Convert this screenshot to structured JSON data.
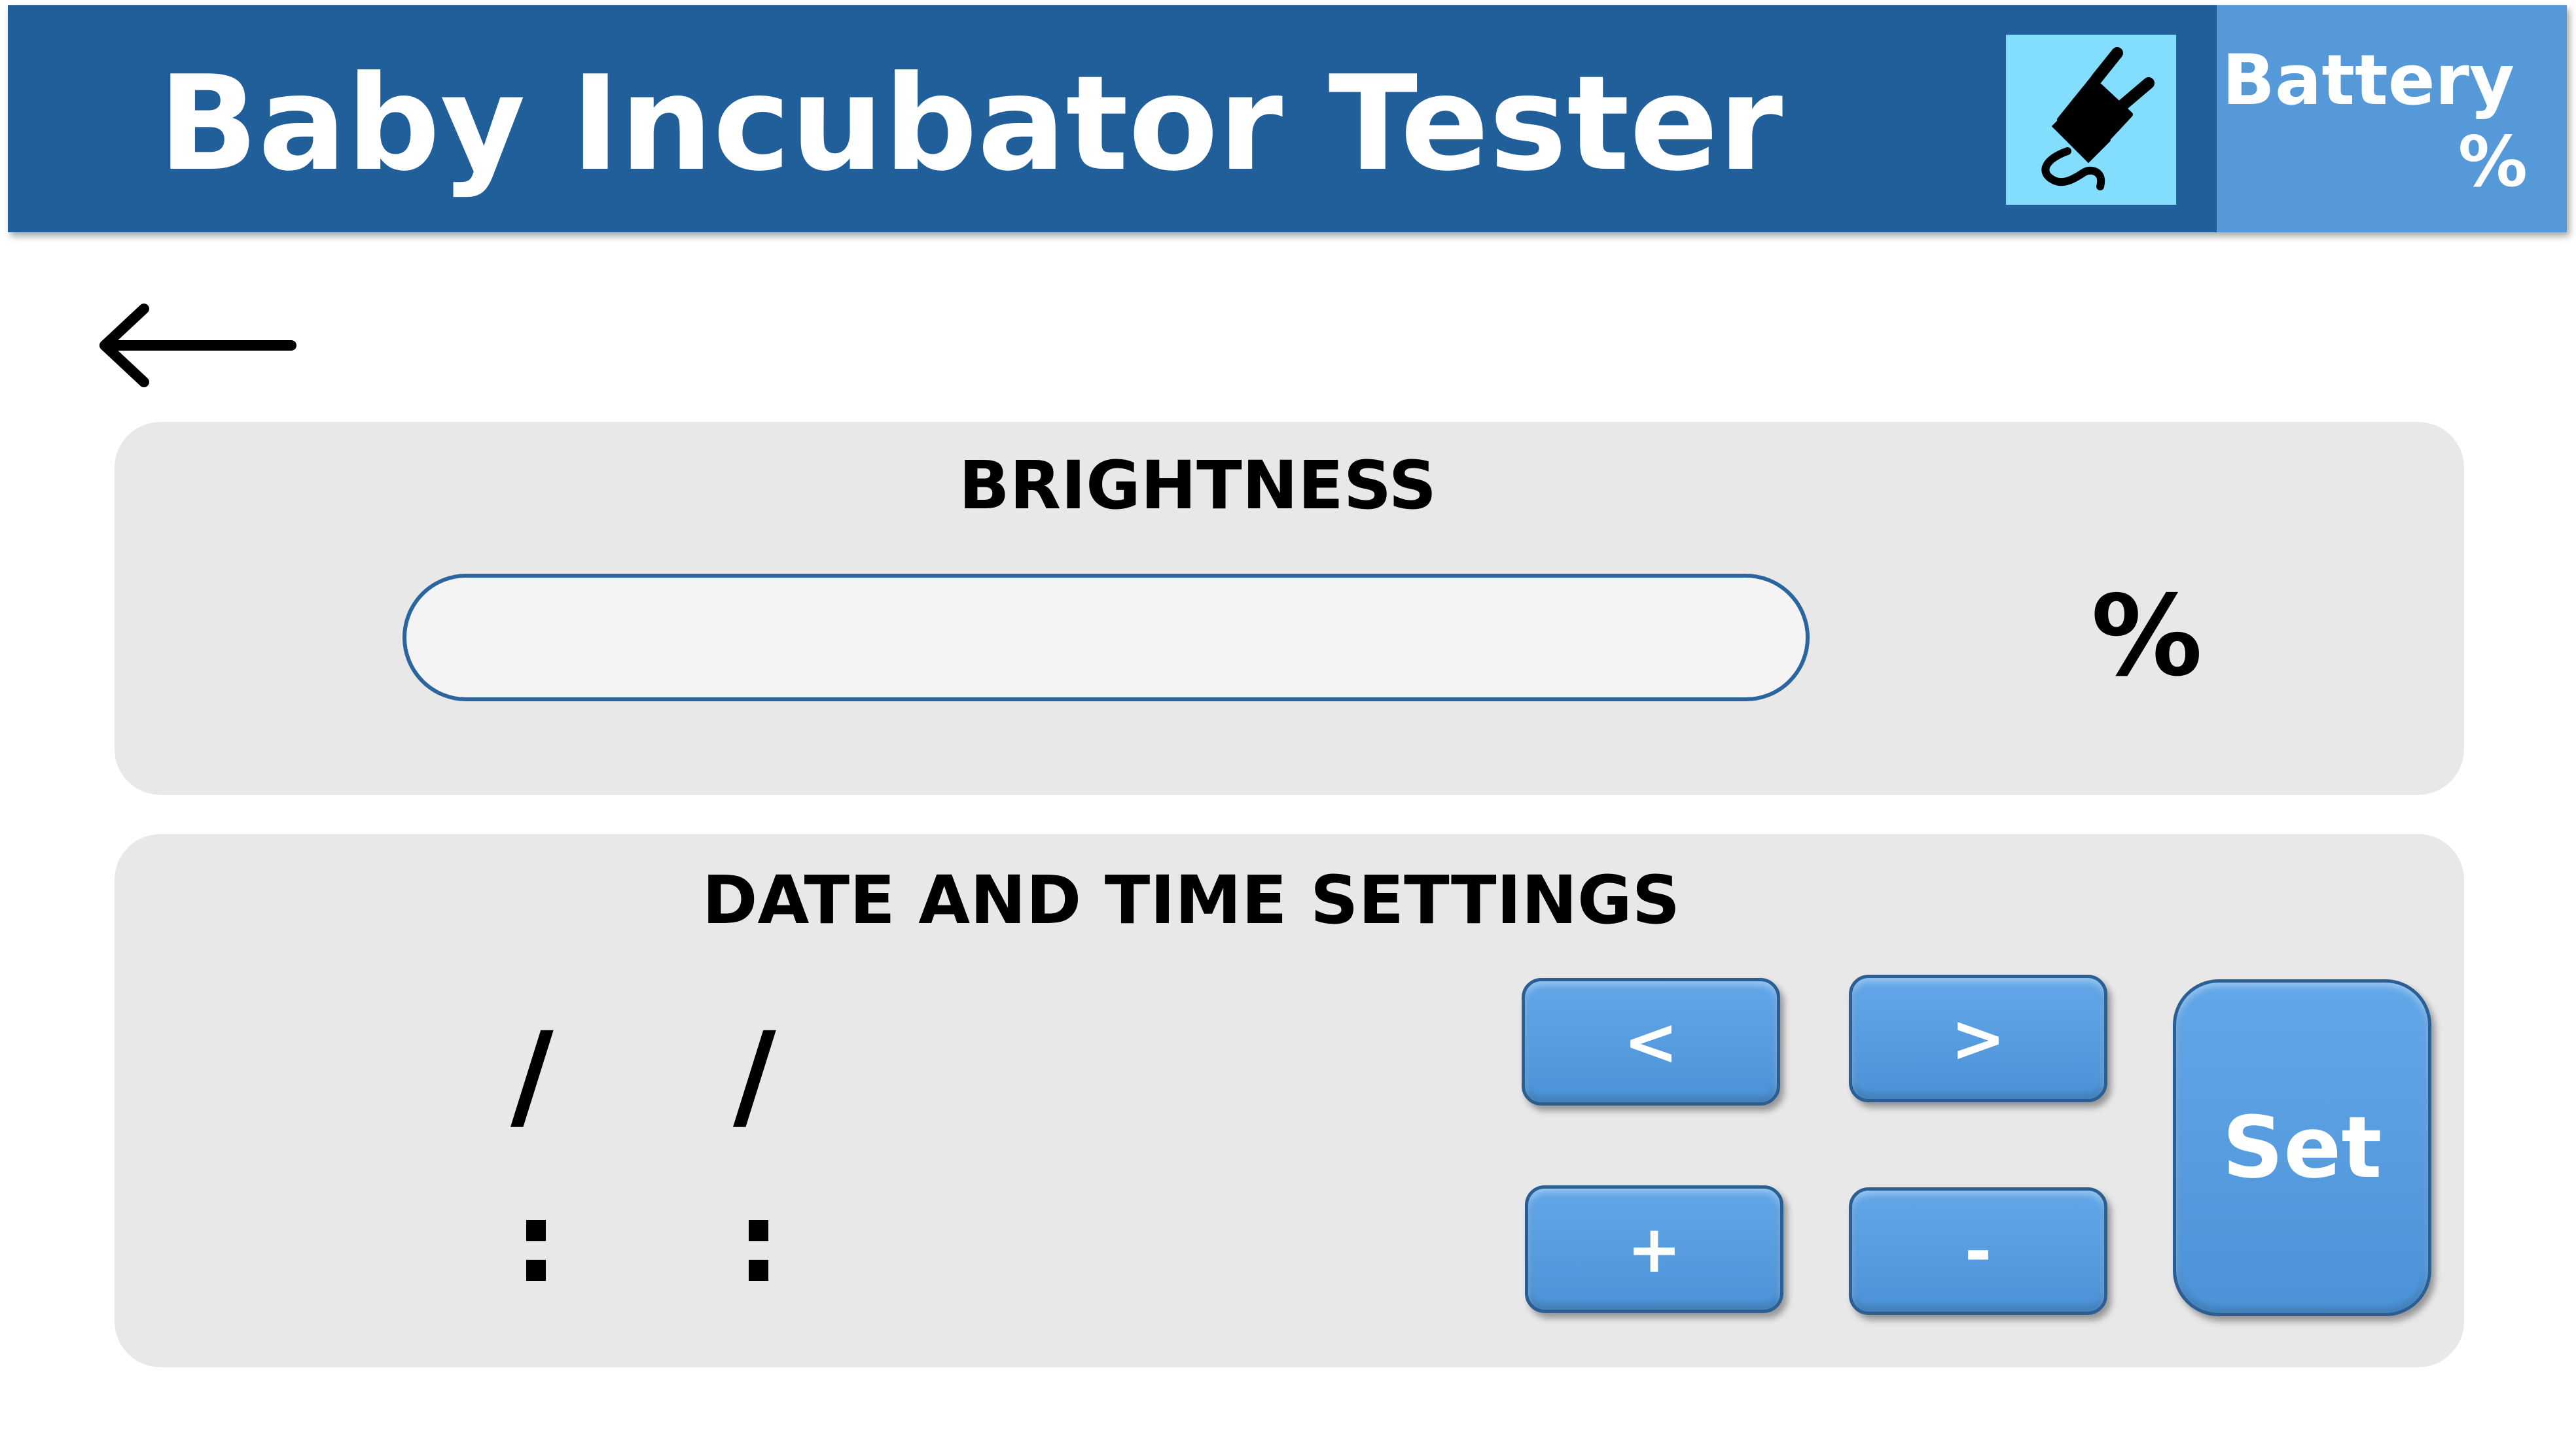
{
  "header": {
    "title": "Baby Incubator Tester",
    "power_icon": "plug-icon",
    "battery_label": "Battery",
    "battery_percent": "%"
  },
  "navigation": {
    "back_icon": "arrow-left-icon"
  },
  "brightness": {
    "title": "BRIGHTNESS",
    "percent_label": "%"
  },
  "datetime": {
    "title": "DATE AND TIME SETTINGS",
    "date_separator": "/",
    "time_separator": ":",
    "buttons": {
      "left": "<",
      "right": ">",
      "plus": "+",
      "minus": "-",
      "set": "Set"
    }
  },
  "colors": {
    "header_background": "#215f9a",
    "power_box": "#83ddfd",
    "battery_box": "#5599d9",
    "panel_background": "#e8e8e8",
    "button_blue": "#5599d9",
    "slider_border": "#2a65a0"
  }
}
